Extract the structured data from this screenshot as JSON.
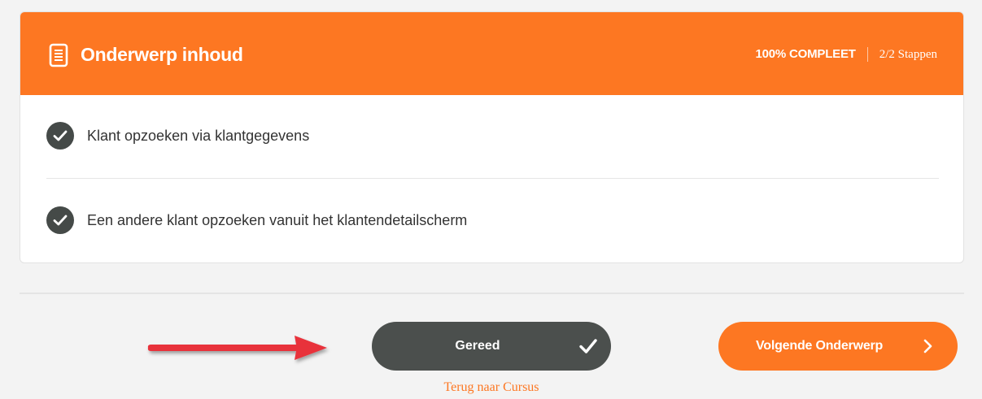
{
  "header": {
    "icon": "document-icon",
    "title": "Onderwerp inhoud",
    "progress_percent": "100% COMPLEET",
    "progress_steps": "2/2 Stappen",
    "accent_color": "#fd7722"
  },
  "steps": [
    {
      "label": "Klant opzoeken via klantgegevens",
      "icon": "check-circle-icon",
      "completed": true
    },
    {
      "label": "Een andere klant opzoeken vanuit het klantendetailscherm",
      "icon": "check-circle-icon",
      "completed": true
    }
  ],
  "actions": {
    "done_label": "Gereed",
    "done_icon": "checkmark-icon",
    "next_label": "Volgende Onderwerp",
    "next_icon": "chevron-right-icon",
    "back_link": "Terug naar Cursus",
    "annotation": "red-arrow-icon"
  },
  "colors": {
    "orange": "#fd7722",
    "dark": "#4b4f4d",
    "arrow_red": "#e8303a"
  }
}
